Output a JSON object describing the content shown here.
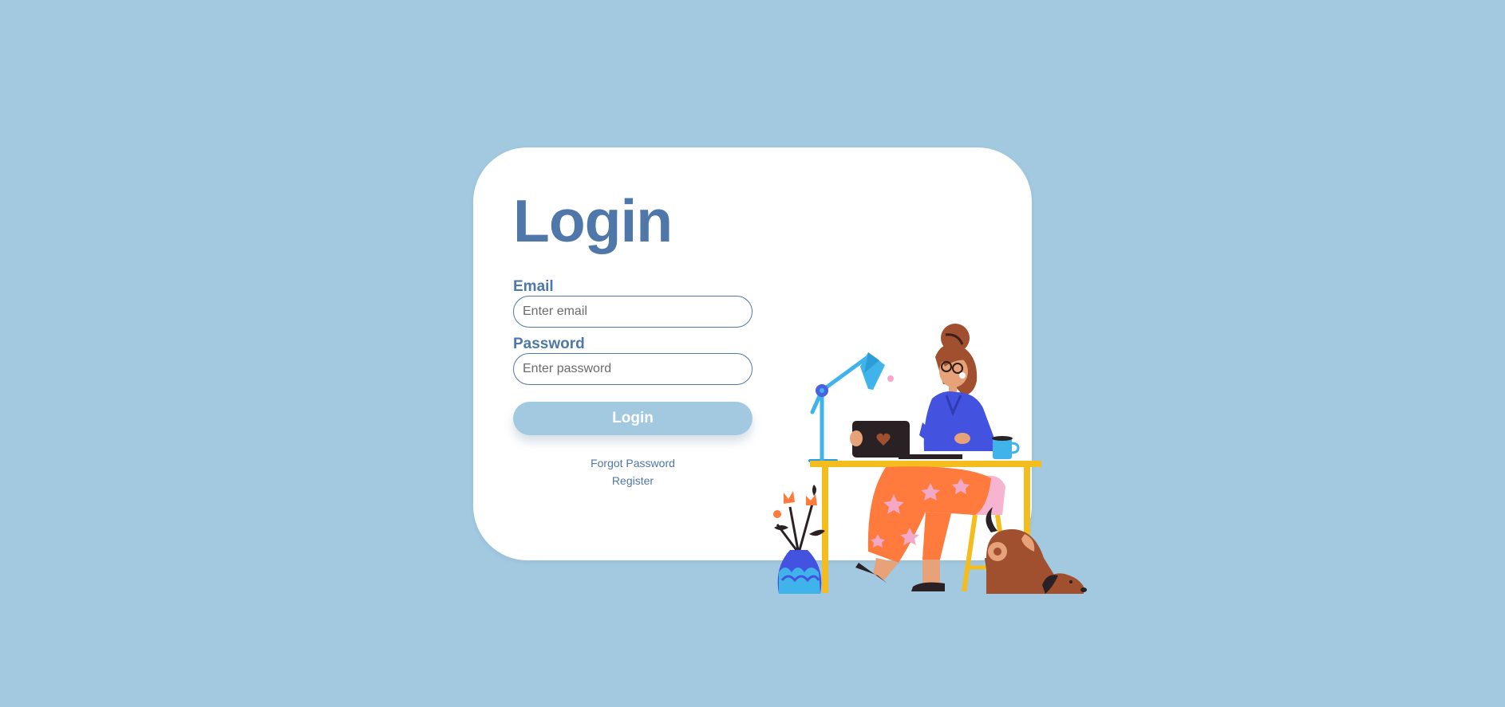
{
  "login": {
    "title": "Login",
    "email_label": "Email",
    "email_placeholder": "Enter email",
    "email_value": "",
    "password_label": "Password",
    "password_placeholder": "Enter password",
    "password_value": "",
    "submit_label": "Login",
    "forgot_password": "Forgot Password",
    "register": "Register"
  },
  "colors": {
    "background": "#a3c9e0",
    "accent": "#4f77aa",
    "card": "#ffffff"
  }
}
